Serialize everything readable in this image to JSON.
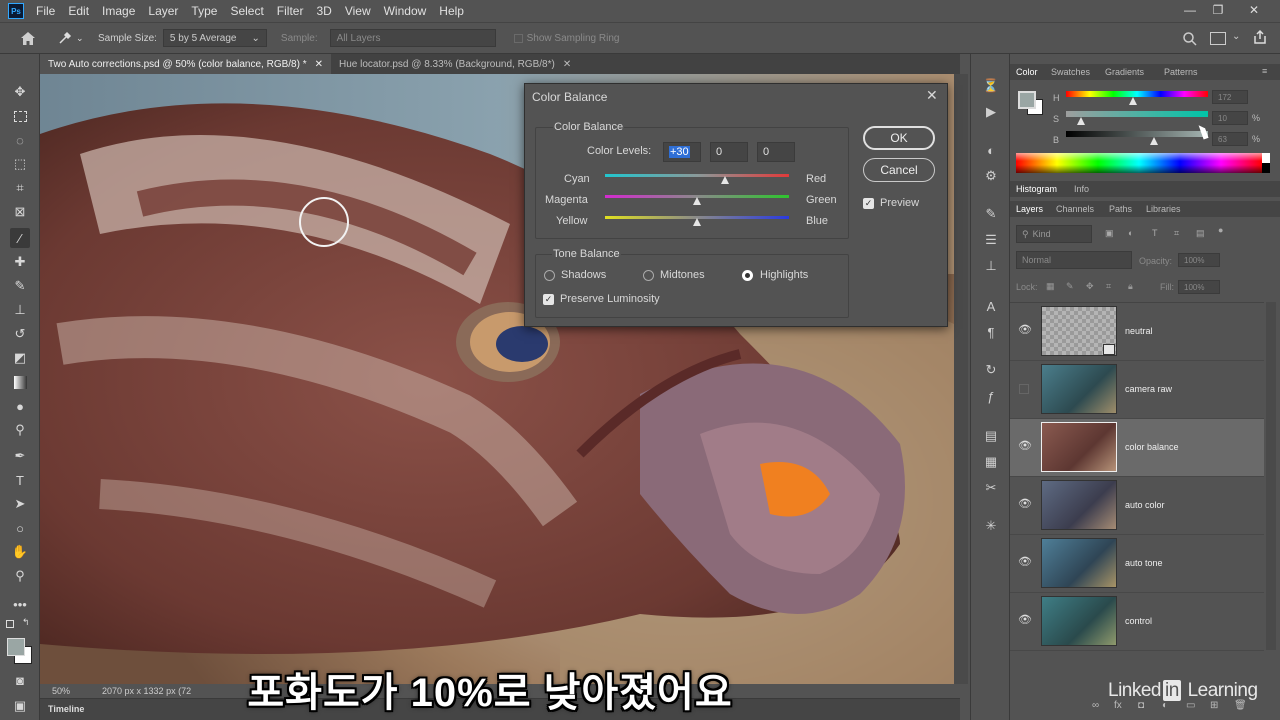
{
  "app": {
    "logo_text": "Ps"
  },
  "menu": [
    "File",
    "Edit",
    "Image",
    "Layer",
    "Type",
    "Select",
    "Filter",
    "3D",
    "View",
    "Window",
    "Help"
  ],
  "window_controls": {
    "minimize": "—",
    "restore": "❐",
    "close": "✕"
  },
  "options_bar": {
    "sample_size_label": "Sample Size:",
    "sample_size_value": "5 by 5 Average",
    "sample_label": "Sample:",
    "sample_value": "All Layers",
    "show_sampling_ring": "Show Sampling Ring"
  },
  "doc_tabs": [
    {
      "label": "Two Auto corrections.psd @ 50% (color balance, RGB/8) *",
      "active": true
    },
    {
      "label": "Hue locator.psd @ 8.33% (Background, RGB/8*)",
      "active": false
    }
  ],
  "status_bar": {
    "zoom": "50%",
    "info": "2070 px x 1332 px (72"
  },
  "timeline_label": "Timeline",
  "dialog": {
    "title": "Color Balance",
    "close": "✕",
    "section_color_balance": "Color Balance",
    "color_levels_label": "Color Levels:",
    "levels": [
      "+30",
      "0",
      "0"
    ],
    "sliders": [
      {
        "left": "Cyan",
        "right": "Red",
        "value": 30
      },
      {
        "left": "Magenta",
        "right": "Green",
        "value": 0
      },
      {
        "left": "Yellow",
        "right": "Blue",
        "value": 0
      }
    ],
    "section_tone_balance": "Tone Balance",
    "tones": [
      "Shadows",
      "Midtones",
      "Highlights"
    ],
    "selected_tone": "Highlights",
    "preserve_luminosity": "Preserve Luminosity",
    "ok": "OK",
    "cancel": "Cancel",
    "preview": "Preview"
  },
  "color_panel": {
    "tabs": [
      "Color",
      "Swatches",
      "Gradients",
      "Patterns"
    ],
    "channels": [
      {
        "label": "H",
        "value": "172",
        "unit": ""
      },
      {
        "label": "S",
        "value": "10",
        "unit": "%"
      },
      {
        "label": "B",
        "value": "63",
        "unit": "%"
      }
    ],
    "foreground": "#9aa6a4"
  },
  "histogram_tabs": [
    "Histogram",
    "Info"
  ],
  "layers_panel": {
    "tabs": [
      "Layers",
      "Channels",
      "Paths",
      "Libraries"
    ],
    "kind_placeholder": "Kind",
    "blend_mode": "Normal",
    "opacity_label": "Opacity:",
    "opacity_value": "100%",
    "lock_label": "Lock:",
    "fill_label": "Fill:",
    "fill_value": "100%",
    "layers": [
      {
        "name": "neutral",
        "visible": true,
        "selected": false
      },
      {
        "name": "camera raw",
        "visible": false,
        "selected": false
      },
      {
        "name": "color balance",
        "visible": true,
        "selected": true
      },
      {
        "name": "auto color",
        "visible": true,
        "selected": false
      },
      {
        "name": "auto tone",
        "visible": true,
        "selected": false
      },
      {
        "name": "control",
        "visible": true,
        "selected": false
      }
    ]
  },
  "subtitle": "포화도가 10%로 낮아졌어요",
  "watermark": {
    "pre": "Linked",
    "in": "in",
    "post": " Learning"
  }
}
